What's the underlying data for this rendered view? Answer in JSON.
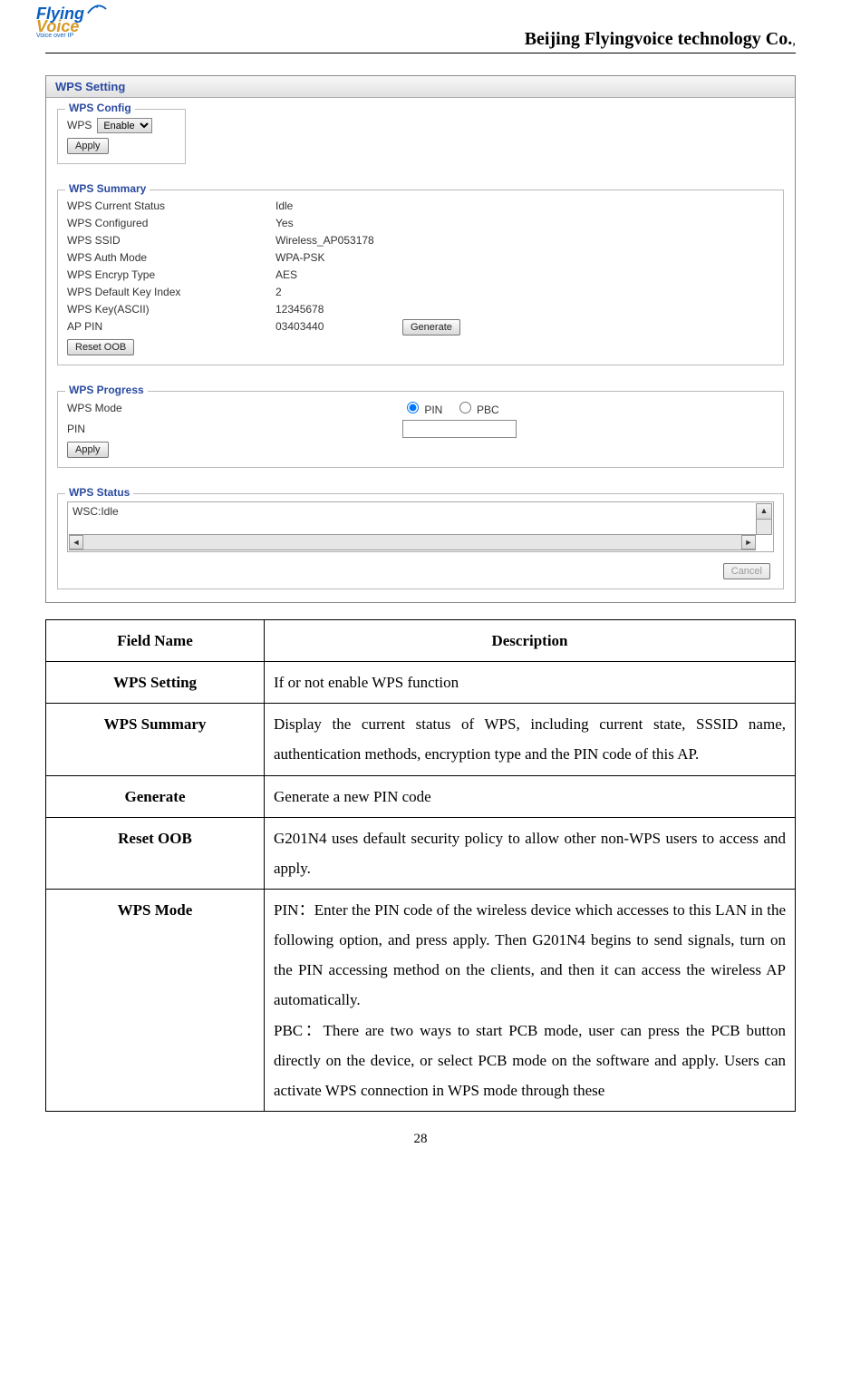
{
  "header": {
    "logo_top": "Flying",
    "logo_bottom": "Voice",
    "logo_tag": "Voice over IP",
    "company": "Beijing Flyingvoice technology Co.",
    "company_trailing": ","
  },
  "screenshot": {
    "title": "WPS Setting",
    "config": {
      "legend": "WPS Config",
      "wps_label": "WPS",
      "wps_value": "Enable",
      "apply": "Apply"
    },
    "summary": {
      "legend": "WPS Summary",
      "rows": [
        {
          "label": "WPS Current Status",
          "value": "Idle"
        },
        {
          "label": "WPS Configured",
          "value": "Yes"
        },
        {
          "label": "WPS SSID",
          "value": "Wireless_AP053178"
        },
        {
          "label": "WPS Auth Mode",
          "value": "WPA-PSK"
        },
        {
          "label": "WPS Encryp Type",
          "value": "AES"
        },
        {
          "label": "WPS Default Key Index",
          "value": "2"
        },
        {
          "label": "WPS Key(ASCII)",
          "value": "12345678"
        },
        {
          "label": "AP PIN",
          "value": "03403440"
        }
      ],
      "generate": "Generate",
      "reset_oob": "Reset OOB"
    },
    "progress": {
      "legend": "WPS Progress",
      "mode_label": "WPS Mode",
      "mode_pin": "PIN",
      "mode_pbc": "PBC",
      "pin_label": "PIN",
      "pin_value": "",
      "apply": "Apply"
    },
    "status": {
      "legend": "WPS Status",
      "text": "WSC:Idle",
      "cancel": "Cancel"
    }
  },
  "desc_table": {
    "head_field": "Field Name",
    "head_desc": "Description",
    "rows": [
      {
        "field": "WPS Setting",
        "desc": "If or not enable WPS function"
      },
      {
        "field": "WPS Summary",
        "desc": "Display the current status of WPS, including current state, SSSID name, authentication methods, encryption type and the PIN code of this AP."
      },
      {
        "field": "Generate",
        "desc": "Generate a new PIN code"
      },
      {
        "field": "Reset OOB",
        "desc": "G201N4 uses default security policy to allow other non-WPS users to access and apply."
      },
      {
        "field": "WPS Mode",
        "desc": "PIN：Enter the PIN code of the wireless device which accesses to this LAN in the following option, and press apply. Then G201N4 begins to send signals, turn on the PIN accessing method on the clients, and then it can access the wireless AP automatically.\nPBC：There are two ways to start PCB mode, user can press the PCB button directly on the device, or select PCB mode on the software and apply. Users can activate WPS connection in WPS mode through these"
      }
    ]
  },
  "page_number": "28"
}
